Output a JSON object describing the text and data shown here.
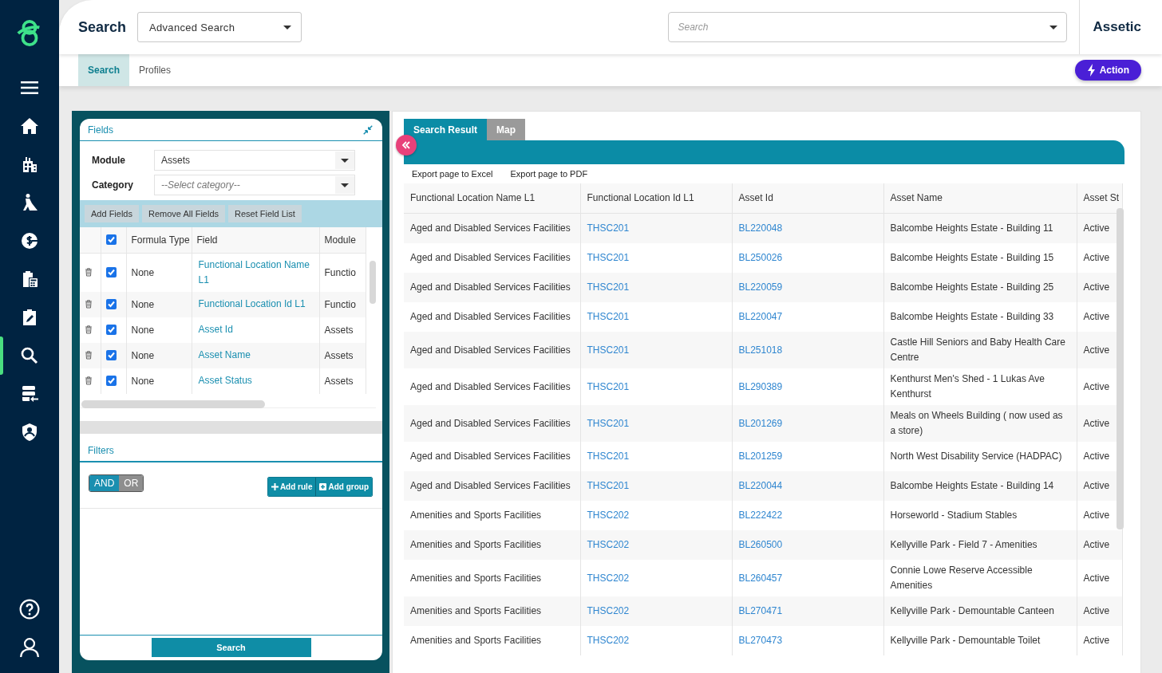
{
  "sidebar": {
    "items": [
      {
        "kind": "menu",
        "selected": false
      },
      {
        "kind": "home",
        "selected": false
      },
      {
        "kind": "building",
        "selected": false
      },
      {
        "kind": "worker",
        "selected": false
      },
      {
        "kind": "coin",
        "selected": false
      },
      {
        "kind": "clipboard-calc",
        "selected": false
      },
      {
        "kind": "clipboard-edit",
        "selected": false
      },
      {
        "kind": "search",
        "selected": true
      },
      {
        "kind": "list-import",
        "selected": false
      },
      {
        "kind": "shield-user",
        "selected": false
      }
    ],
    "bottom_items": [
      {
        "kind": "help"
      },
      {
        "kind": "user"
      }
    ]
  },
  "header": {
    "title": "Search",
    "mode_dropdown": {
      "value": "Advanced Search"
    },
    "search": {
      "placeholder": "Search"
    },
    "brand": "Assetic"
  },
  "subtabs": [
    {
      "label": "Search",
      "selected": true
    },
    {
      "label": "Profiles",
      "selected": false
    }
  ],
  "action_button": {
    "label": "Action"
  },
  "fields_panel": {
    "title": "Fields",
    "module": {
      "label": "Module",
      "value": "Assets"
    },
    "category": {
      "label": "Category",
      "placeholder": "--Select category--"
    },
    "toolbar": [
      "Add Fields",
      "Remove All Fields",
      "Reset Field List"
    ],
    "table": {
      "header_checked": true,
      "columns": [
        "Formula Type",
        "Field",
        "Module"
      ],
      "rows": [
        {
          "checked": true,
          "formula_type": "None",
          "field": "Functional Location Name L1",
          "module": "Functio"
        },
        {
          "checked": true,
          "formula_type": "None",
          "field": "Functional Location Id L1",
          "module": "Functio"
        },
        {
          "checked": true,
          "formula_type": "None",
          "field": "Asset Id",
          "module": "Assets"
        },
        {
          "checked": true,
          "formula_type": "None",
          "field": "Asset Name",
          "module": "Assets"
        },
        {
          "checked": true,
          "formula_type": "None",
          "field": "Asset Status",
          "module": "Assets"
        }
      ]
    }
  },
  "filters": {
    "title": "Filters",
    "logic": [
      {
        "label": "AND",
        "selected": true
      },
      {
        "label": "OR",
        "selected": false
      }
    ],
    "buttons": [
      {
        "kind": "plus",
        "label": "Add rule"
      },
      {
        "kind": "plus-square",
        "label": "Add group"
      }
    ]
  },
  "search_button": {
    "label": "Search"
  },
  "results": {
    "tabs": [
      {
        "label": "Search Result",
        "selected": true
      },
      {
        "label": "Map",
        "selected": false
      }
    ],
    "exports": [
      "Export page to Excel",
      "Export page to PDF"
    ],
    "columns": [
      "Functional Location Name L1",
      "Functional Location Id L1",
      "Asset Id",
      "Asset Name",
      "Asset St"
    ],
    "rows": [
      [
        "Aged and Disabled Services Facilities",
        "THSC201",
        "BL220048",
        "Balcombe Heights Estate - Building 11",
        "Active"
      ],
      [
        "Aged and Disabled Services Facilities",
        "THSC201",
        "BL250026",
        "Balcombe Heights Estate - Building 15",
        "Active"
      ],
      [
        "Aged and Disabled Services Facilities",
        "THSC201",
        "BL220059",
        "Balcombe Heights Estate - Building 25",
        "Active"
      ],
      [
        "Aged and Disabled Services Facilities",
        "THSC201",
        "BL220047",
        "Balcombe Heights Estate - Building 33",
        "Active"
      ],
      [
        "Aged and Disabled Services Facilities",
        "THSC201",
        "BL251018",
        "Castle Hill Seniors and Baby Health Care Centre",
        "Active"
      ],
      [
        "Aged and Disabled Services Facilities",
        "THSC201",
        "BL290389",
        "Kenthurst Men's Shed - 1 Lukas Ave Kenthurst",
        "Active"
      ],
      [
        "Aged and Disabled Services Facilities",
        "THSC201",
        "BL201269",
        "Meals on Wheels Building ( now used as a store)",
        "Active"
      ],
      [
        "Aged and Disabled Services Facilities",
        "THSC201",
        "BL201259",
        "North West Disability Service (HADPAC)",
        "Active"
      ],
      [
        "Aged and Disabled Services Facilities",
        "THSC201",
        "BL220044",
        "Balcombe Heights Estate - Building 14",
        "Active"
      ],
      [
        "Amenities and Sports Facilities",
        "THSC202",
        "BL222422",
        "Horseworld - Stadium Stables",
        "Active"
      ],
      [
        "Amenities and Sports Facilities",
        "THSC202",
        "BL260500",
        "Kellyville Park - Field 7 - Amenities",
        "Active"
      ],
      [
        "Amenities and Sports Facilities",
        "THSC202",
        "BL260457",
        "Connie Lowe Reserve Accessible Amenities",
        "Active"
      ],
      [
        "Amenities and Sports Facilities",
        "THSC202",
        "BL270471",
        "Kellyville Park - Demountable Canteen",
        "Active"
      ],
      [
        "Amenities and Sports Facilities",
        "THSC202",
        "BL270473",
        "Kellyville Park - Demountable Toilet",
        "Active"
      ]
    ]
  }
}
